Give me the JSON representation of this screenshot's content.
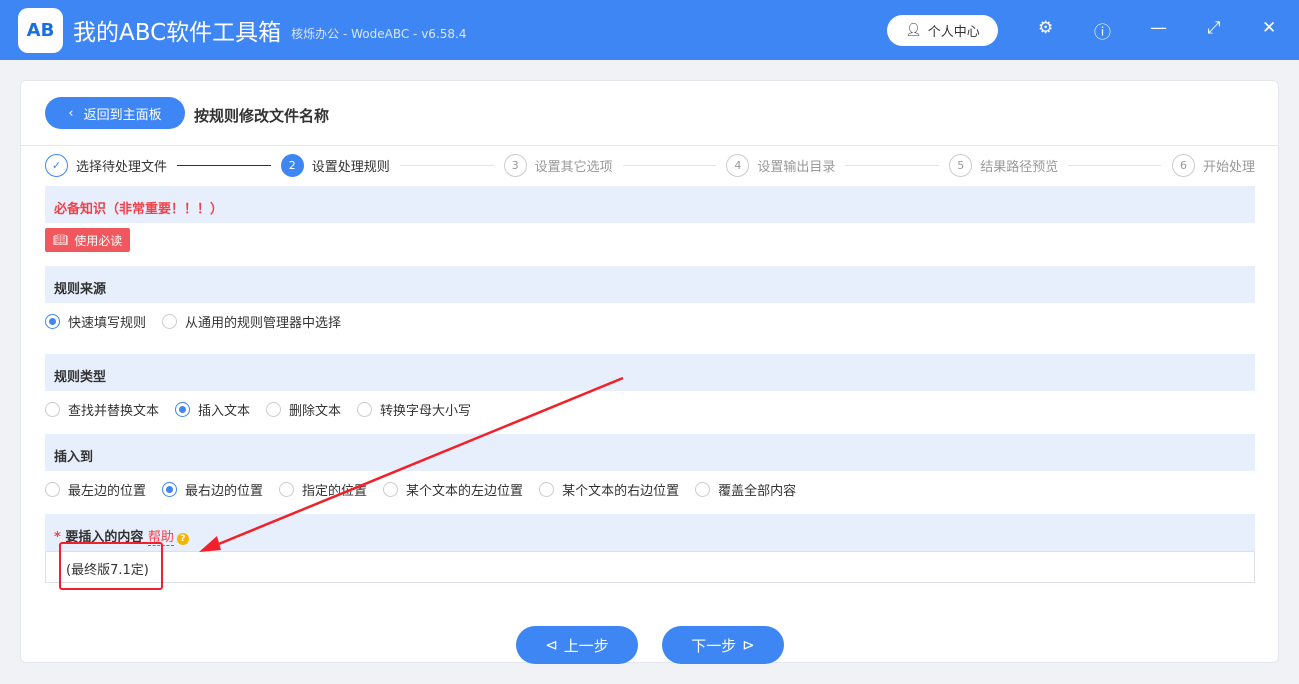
{
  "app": {
    "logo": "AB",
    "title": "我的ABC软件工具箱",
    "subtitle": "核烁办公 - WodeABC - v6.58.4",
    "user": "个人中心"
  },
  "page": {
    "back": "返回到主面板",
    "title": "按规则修改文件名称"
  },
  "steps": [
    {
      "n": "✓",
      "label": "选择待处理文件"
    },
    {
      "n": "2",
      "label": "设置处理规则"
    },
    {
      "n": "3",
      "label": "设置其它选项"
    },
    {
      "n": "4",
      "label": "设置输出目录"
    },
    {
      "n": "5",
      "label": "结果路径预览"
    },
    {
      "n": "6",
      "label": "开始处理"
    }
  ],
  "notice": {
    "title": "必备知识（非常重要！！！）",
    "button": "使用必读"
  },
  "source": {
    "title": "规则来源",
    "options": [
      "快速填写规则",
      "从通用的规则管理器中选择"
    ]
  },
  "type": {
    "title": "规则类型",
    "options": [
      "查找并替换文本",
      "插入文本",
      "删除文本",
      "转换字母大小写"
    ]
  },
  "insert_to": {
    "title": "插入到",
    "options": [
      "最左边的位置",
      "最右边的位置",
      "指定的位置",
      "某个文本的左边位置",
      "某个文本的右边位置",
      "覆盖全部内容"
    ]
  },
  "content": {
    "required": "*",
    "title": "要插入的内容",
    "help": "帮助",
    "value": "(最终版7.1定)"
  },
  "nav": {
    "prev": "上一步",
    "next": "下一步"
  }
}
